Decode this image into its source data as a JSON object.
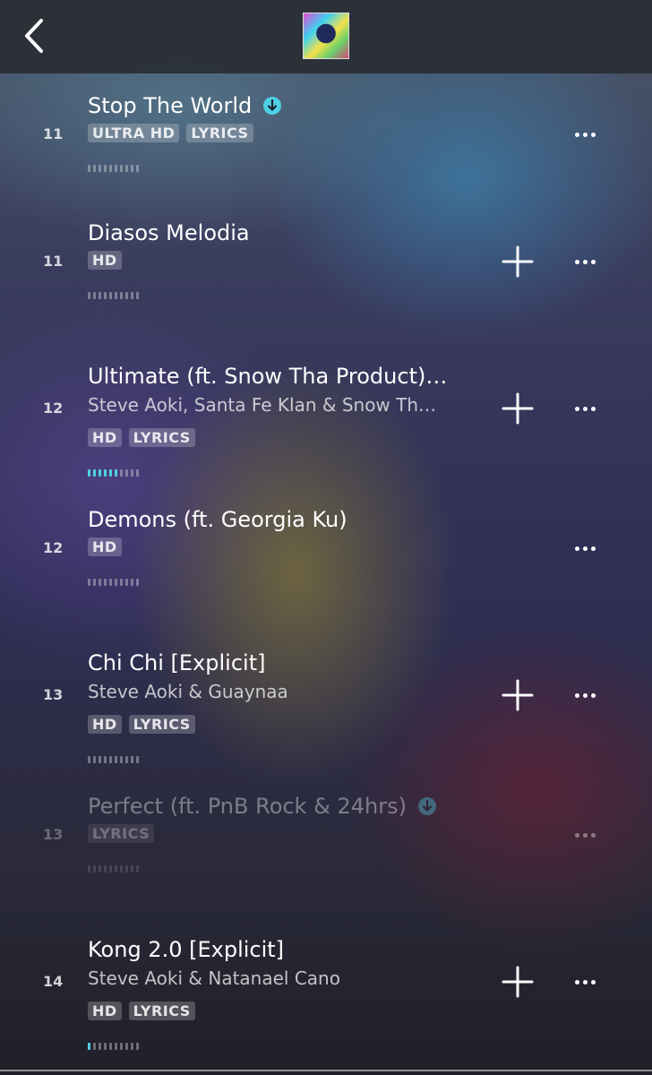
{
  "tracks": [
    {
      "rank": "11",
      "title": "Stop The World",
      "artist": "",
      "badges": [
        "ULTRA HD",
        "LYRICS"
      ],
      "downloaded": true,
      "can_add": false,
      "dimmed": false,
      "progress_active_bars": 0
    },
    {
      "rank": "11",
      "title": "Diasos Melodia",
      "artist": "",
      "badges": [
        "HD"
      ],
      "downloaded": false,
      "can_add": true,
      "dimmed": false,
      "progress_active_bars": 0
    },
    {
      "rank": "12",
      "title": "Ultimate (ft. Snow Tha Product)…",
      "artist": "Steve Aoki, Santa Fe Klan & Snow Th…",
      "badges": [
        "HD",
        "LYRICS"
      ],
      "downloaded": false,
      "can_add": true,
      "dimmed": false,
      "progress_active_bars": 6
    },
    {
      "rank": "12",
      "title": "Demons (ft. Georgia Ku)",
      "artist": "",
      "badges": [
        "HD"
      ],
      "downloaded": false,
      "can_add": false,
      "dimmed": false,
      "progress_active_bars": 0
    },
    {
      "rank": "13",
      "title": "Chi Chi [Explicit]",
      "artist": "Steve Aoki & Guaynaa",
      "badges": [
        "HD",
        "LYRICS"
      ],
      "downloaded": false,
      "can_add": true,
      "dimmed": false,
      "progress_active_bars": 0
    },
    {
      "rank": "13",
      "title": "Perfect (ft. PnB Rock & 24hrs)",
      "artist": "",
      "badges": [
        "LYRICS"
      ],
      "downloaded": true,
      "can_add": false,
      "dimmed": true,
      "progress_active_bars": 0
    },
    {
      "rank": "14",
      "title": "Kong 2.0 [Explicit]",
      "artist": "Steve Aoki & Natanael Cano",
      "badges": [
        "HD",
        "LYRICS"
      ],
      "downloaded": false,
      "can_add": true,
      "dimmed": false,
      "progress_active_bars": 1
    }
  ],
  "colors": {
    "accent": "#4fd0e3",
    "header_bg": "#2a2b30"
  },
  "icons": {
    "back": "chevron-left-icon",
    "add": "plus-icon",
    "more": "more-dots-icon",
    "download": "download-icon"
  }
}
